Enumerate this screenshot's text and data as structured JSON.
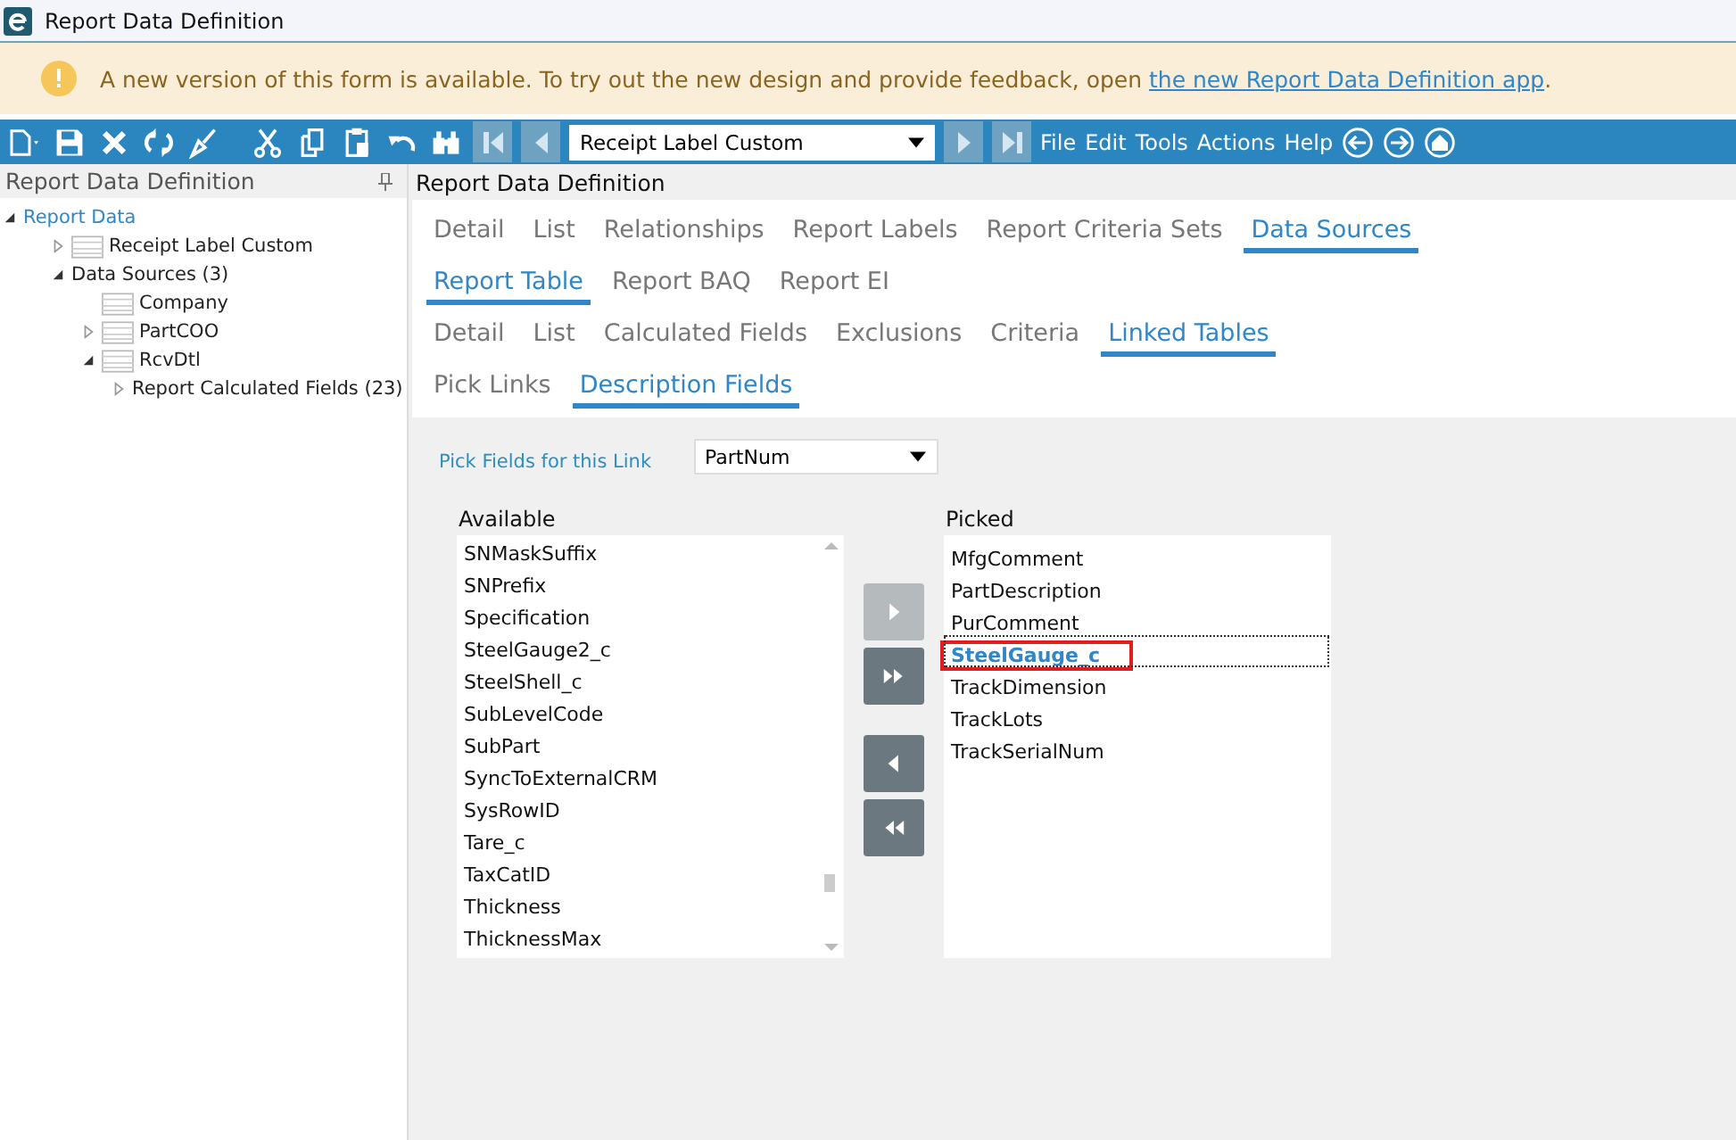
{
  "window": {
    "title": "Report Data Definition"
  },
  "notice": {
    "text": "A new version of this form is available. To try out the new design and provide feedback, open ",
    "link": "the new Report Data Definition app",
    "end": "."
  },
  "toolbar": {
    "record": "Receipt Label Custom",
    "nav_back": [
      {
        "disabled": true
      },
      {
        "disabled": true
      }
    ],
    "nav_forward": [
      {
        "disabled": true
      },
      {
        "disabled": true
      }
    ],
    "menus": [
      "File",
      "Edit",
      "Tools",
      "Actions",
      "Help"
    ]
  },
  "tree_panel": {
    "title": "Report Data Definition",
    "items": [
      {
        "label": "Report Data",
        "expanded": true,
        "selected": true,
        "children": [
          {
            "label": "Receipt Label Custom",
            "kind": "table",
            "expanded": false,
            "selected": false
          },
          {
            "label": "Data Sources (3)",
            "expanded": true,
            "selected": false,
            "children": [
              {
                "label": "Company",
                "kind": "table",
                "selected": false
              },
              {
                "label": "PartCOO",
                "kind": "table",
                "expanded": false,
                "selected": false
              },
              {
                "label": "RcvDtl",
                "kind": "table",
                "expanded": true,
                "selected": false,
                "children": [
                  {
                    "label": "Report Calculated Fields (23)",
                    "expanded": false,
                    "selected": false
                  }
                ]
              }
            ]
          }
        ]
      }
    ]
  },
  "main": {
    "title": "Report Data Definition",
    "tab_rows": [
      [
        {
          "label": "Detail",
          "selected": false
        },
        {
          "label": "List",
          "selected": false
        },
        {
          "label": "Relationships",
          "selected": false
        },
        {
          "label": "Report Labels",
          "selected": false
        },
        {
          "label": "Report Criteria Sets",
          "selected": false
        },
        {
          "label": "Data Sources",
          "selected": true
        }
      ],
      [
        {
          "label": "Report Table",
          "selected": true
        },
        {
          "label": "Report BAQ",
          "selected": false
        },
        {
          "label": "Report EI",
          "selected": false
        }
      ],
      [
        {
          "label": "Detail",
          "selected": false
        },
        {
          "label": "List",
          "selected": false
        },
        {
          "label": "Calculated Fields",
          "selected": false
        },
        {
          "label": "Exclusions",
          "selected": false
        },
        {
          "label": "Criteria",
          "selected": false
        },
        {
          "label": "Linked Tables",
          "selected": true
        }
      ],
      [
        {
          "label": "Pick Links",
          "selected": false
        },
        {
          "label": "Description Fields",
          "selected": true
        }
      ]
    ],
    "pick_label": "Pick Fields for this Link",
    "pick_value": "PartNum",
    "available": {
      "title": "Available",
      "items": [
        "SNMaskSuffix",
        "SNPrefix",
        "Specification",
        "SteelGauge2_c",
        "SteelShell_c",
        "SubLevelCode",
        "SubPart",
        "SyncToExternalCRM",
        "SysRowID",
        "Tare_c",
        "TaxCatID",
        "Thickness",
        "ThicknessMax"
      ]
    },
    "transfer_buttons": [
      {
        "kind": "one-right",
        "disabled": true
      },
      {
        "kind": "all-right",
        "disabled": false
      },
      {
        "kind": "one-left",
        "disabled": false
      },
      {
        "kind": "all-left",
        "disabled": false
      }
    ],
    "picked": {
      "title": "Picked",
      "items": [
        {
          "label": "MfgComment",
          "selected": false,
          "annotated": false
        },
        {
          "label": "PartDescription",
          "selected": false,
          "annotated": false
        },
        {
          "label": "PurComment",
          "selected": false,
          "annotated": false
        },
        {
          "label": "SteelGauge_c",
          "selected": true,
          "annotated": true
        },
        {
          "label": "TrackDimension",
          "selected": false,
          "annotated": false
        },
        {
          "label": "TrackLots",
          "selected": false,
          "annotated": false
        },
        {
          "label": "TrackSerialNum",
          "selected": false,
          "annotated": false
        }
      ]
    }
  }
}
